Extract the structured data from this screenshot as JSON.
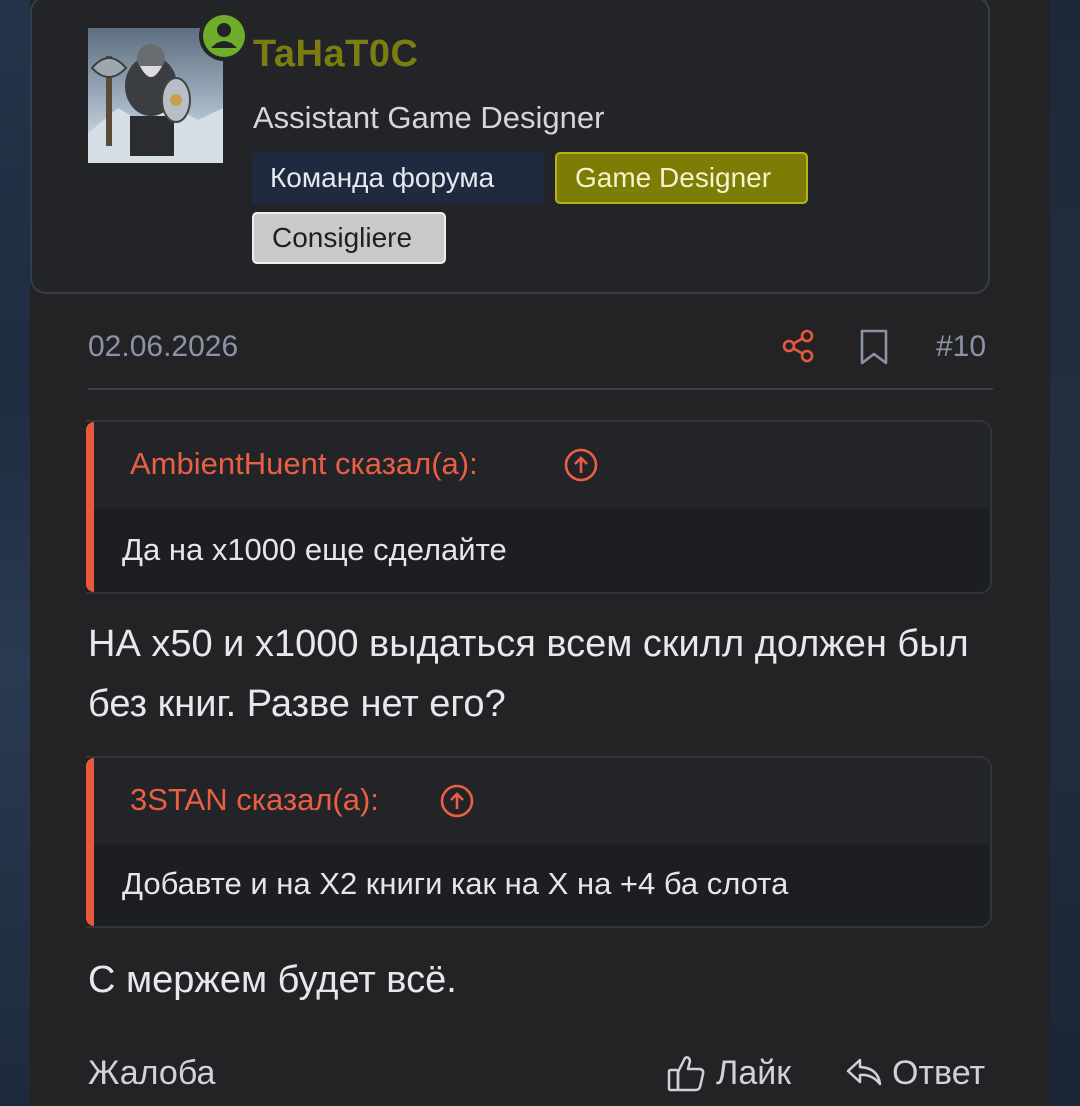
{
  "user": {
    "name": "TaHaT0C",
    "title": "Assistant Game Designer",
    "badges": [
      "Команда форума",
      "Game Designer",
      "Consigliere"
    ],
    "online_icon": "person-online-icon",
    "colors": {
      "name": "#7c7d10",
      "online": "#6fae2a"
    }
  },
  "post": {
    "date": "02.06.2026",
    "number": "#10",
    "icons": [
      "share-icon",
      "bookmark-icon"
    ]
  },
  "quotes": [
    {
      "author": "AmbientHuent сказал(а):",
      "text": "Да на х1000 еще сделайте"
    },
    {
      "author": "3STAN сказал(а):",
      "text": "Добавте и на Х2 книги как на Х на +4 ба слота"
    }
  ],
  "content": {
    "paragraph1": "НА х50 и х1000 выдаться всем скилл должен был без книг. Разве нет его?",
    "paragraph2": "С мержем будет всё."
  },
  "actions": {
    "report": "Жалоба",
    "like": "Лайк",
    "reply": "Ответ"
  },
  "accent_color": "#e8593d"
}
